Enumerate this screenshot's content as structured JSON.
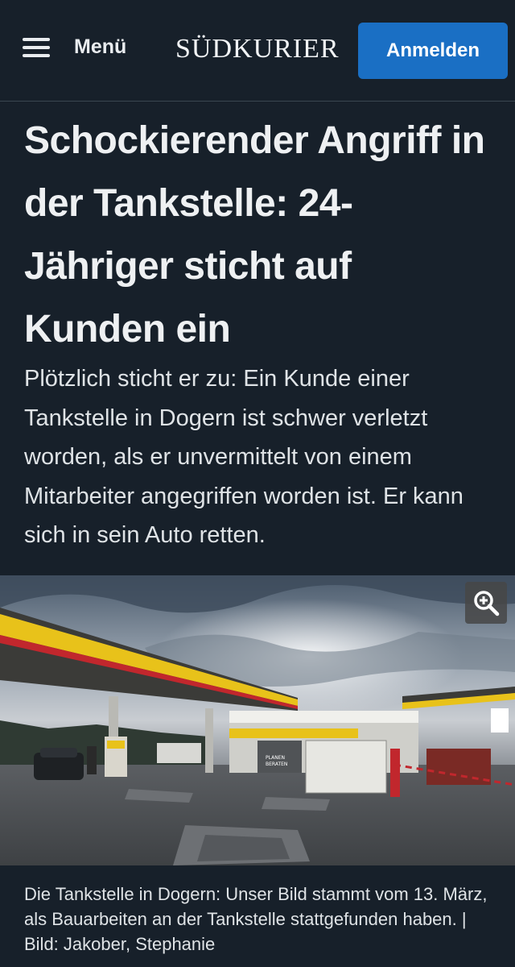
{
  "header": {
    "menu_label": "Menü",
    "logo_text": "SÜDKURIER",
    "login_label": "Anmelden",
    "menu_icon": "hamburger-icon"
  },
  "article": {
    "headline": "Schockierender Angriff in der Tankstelle: 24-Jähriger sticht auf Kunden ein",
    "teaser": "Plötzlich sticht er zu: Ein Kunde einer Tankstelle in Dogern ist schwer verletzt worden, als er unvermittelt von einem Mitarbeiter angegriffen worden ist. Er kann sich in sein Auto retten.",
    "image": {
      "zoom_icon": "zoom-in-icon",
      "sign_text": "PLANEN BERATEN BAUEN"
    },
    "caption": "Die Tankstelle in Dogern: Unser Bild stammt vom 13. März, als Bauarbeiten an der Tankstelle stattgefunden haben. | Bild: Jakober, Stephanie"
  },
  "colors": {
    "background": "#17202a",
    "accent": "#1a6fc4",
    "text": "#e9ecef"
  }
}
